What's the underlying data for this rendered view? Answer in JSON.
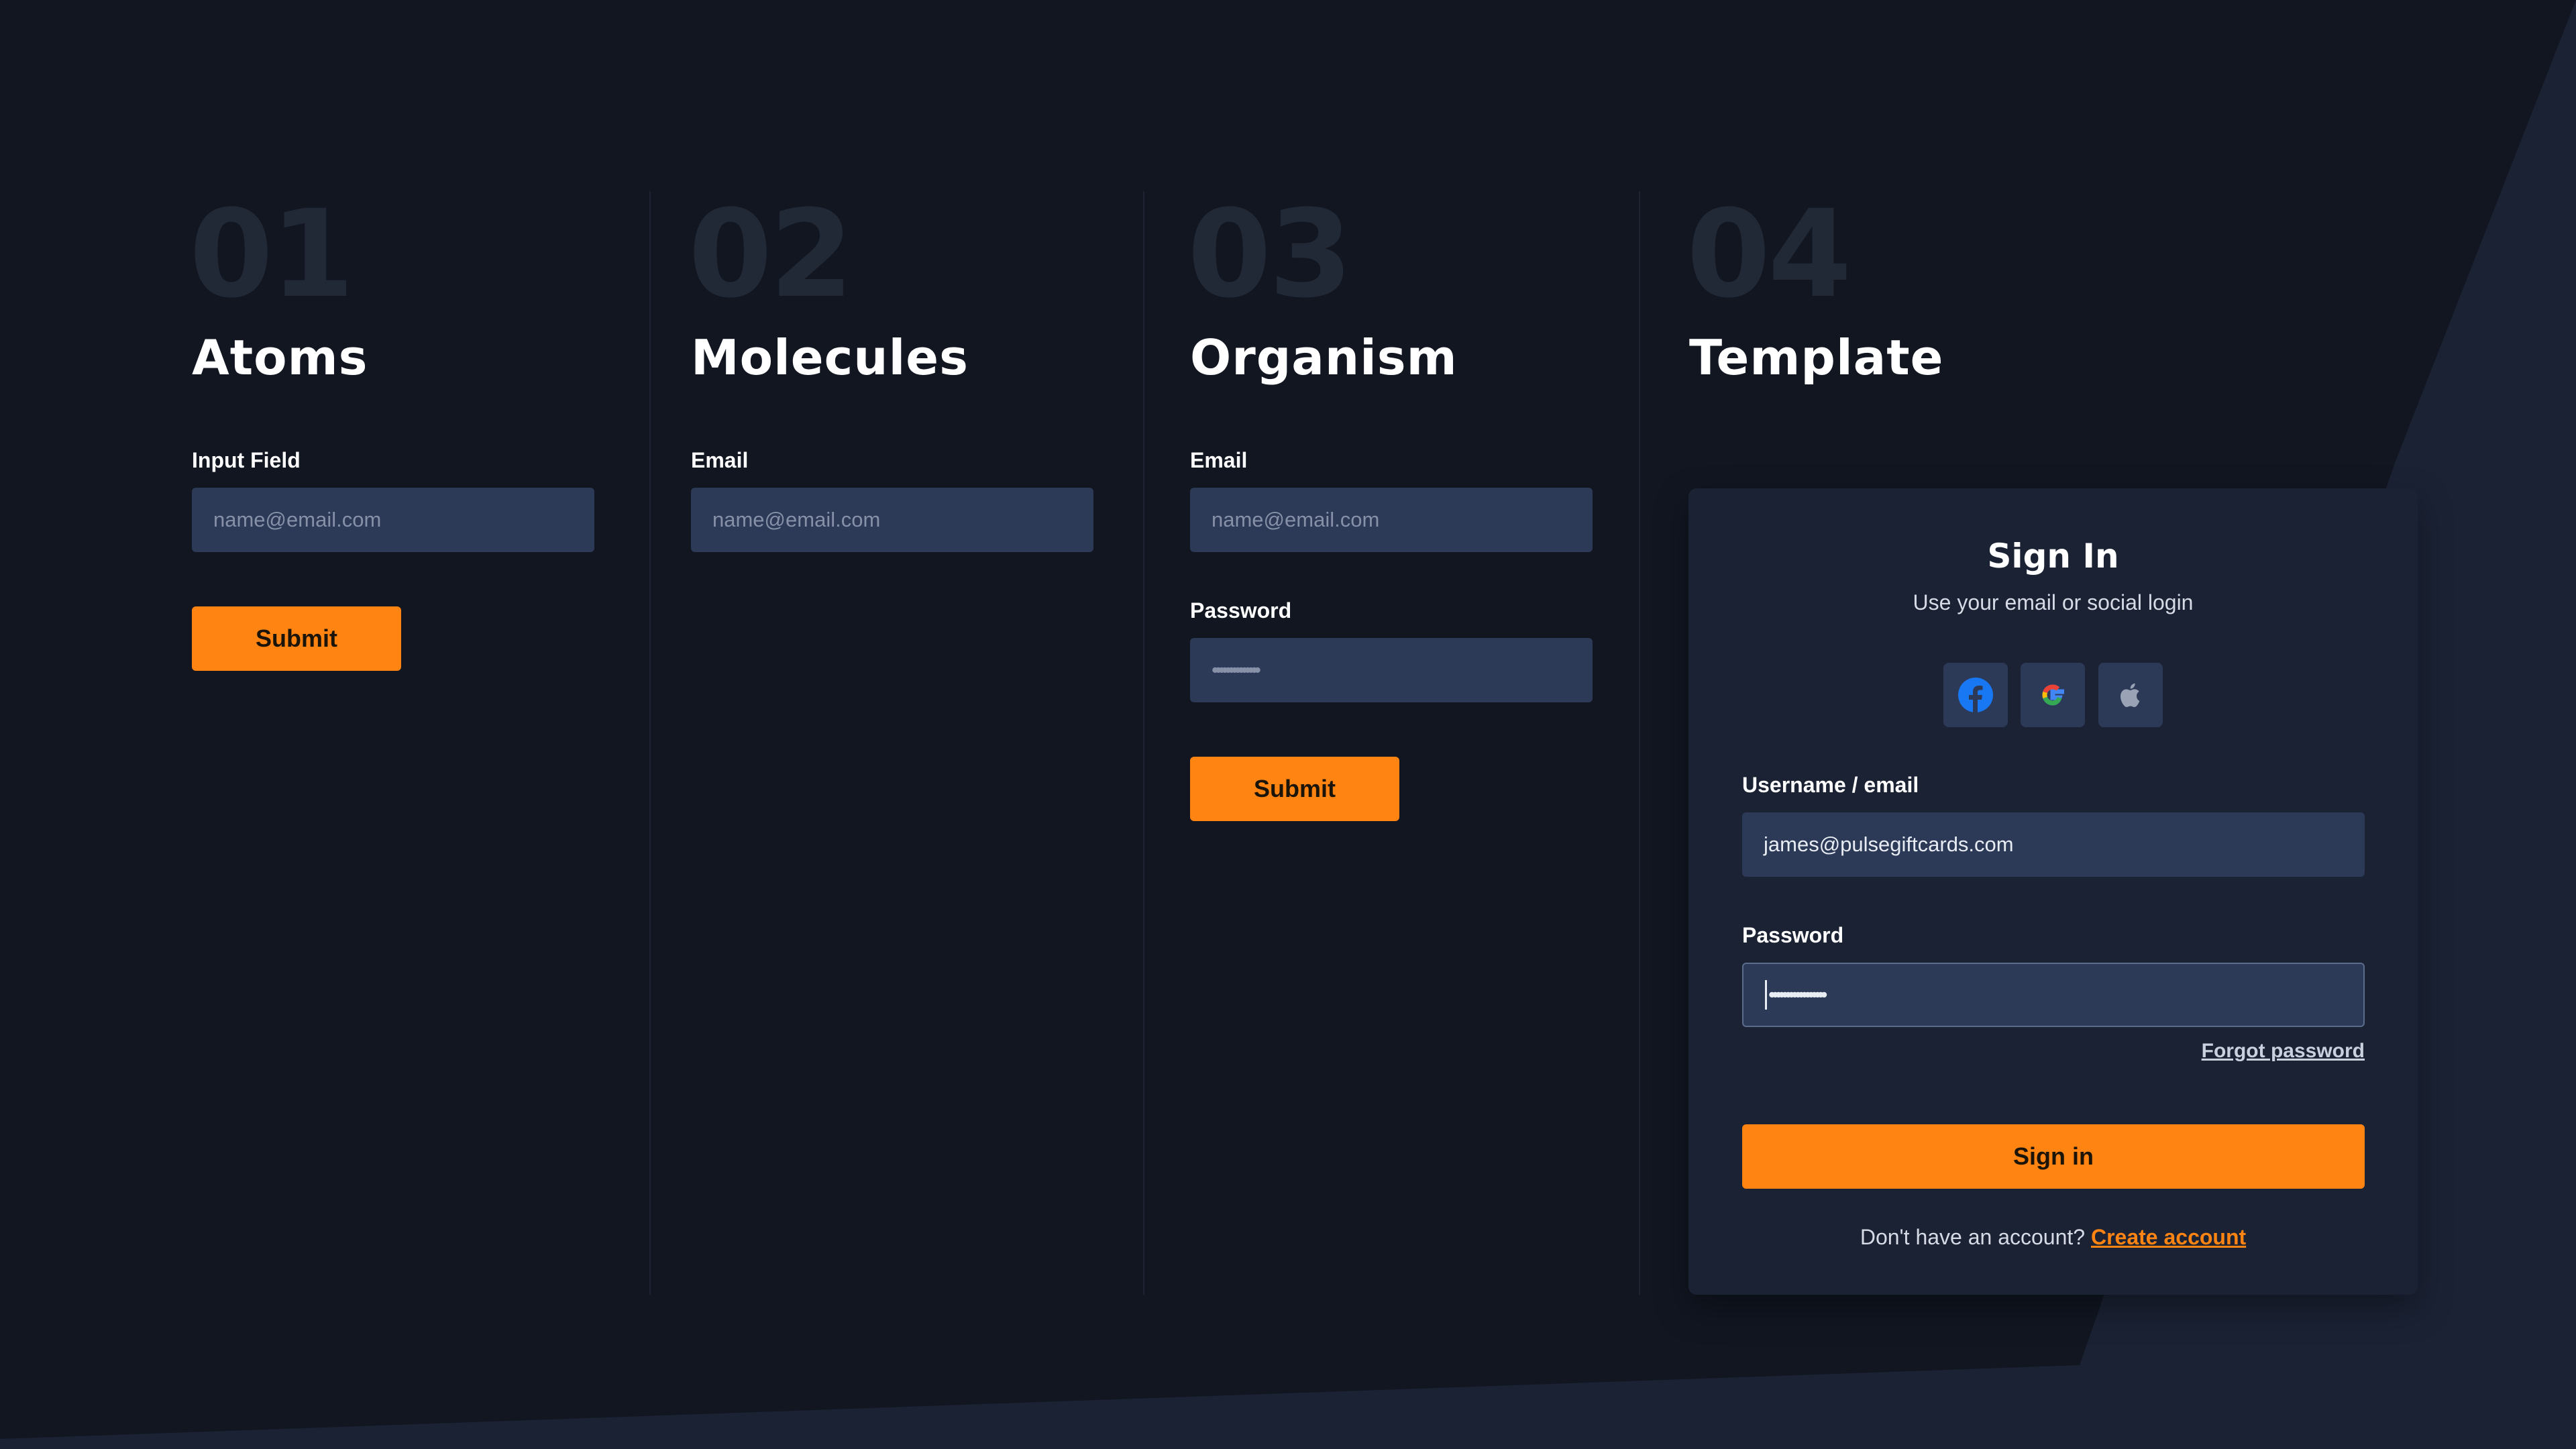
{
  "columns": [
    {
      "number": "01",
      "title": "Atoms",
      "field_label": "Input Field",
      "field_placeholder": "name@email.com",
      "button": "Submit"
    },
    {
      "number": "02",
      "title": "Molecules",
      "field_label": "Email",
      "field_placeholder": "name@email.com"
    },
    {
      "number": "03",
      "title": "Organism",
      "email_label": "Email",
      "email_placeholder": "name@email.com",
      "password_label": "Password",
      "password_masked": "••••••••••••••",
      "button": "Submit"
    },
    {
      "number": "04",
      "title": "Template"
    }
  ],
  "signin": {
    "title": "Sign In",
    "subtitle": "Use your email or social login",
    "social": [
      {
        "icon": "facebook-icon",
        "color": "#1877f2"
      },
      {
        "icon": "google-icon",
        "color": "#ea4335"
      },
      {
        "icon": "apple-icon",
        "color": "#9aa3b5"
      }
    ],
    "username_label": "Username / email",
    "username_value": "james@pulsegiftcards.com",
    "password_label": "Password",
    "password_masked": "•••••••••••••••••",
    "forgot": "Forgot password",
    "button": "Sign in",
    "footer_text": "Don't have an account?",
    "footer_link": "Create account"
  },
  "colors": {
    "accent": "#ff8412",
    "background": "#111621",
    "input": "#2c3a58",
    "card": "#1b2234"
  }
}
